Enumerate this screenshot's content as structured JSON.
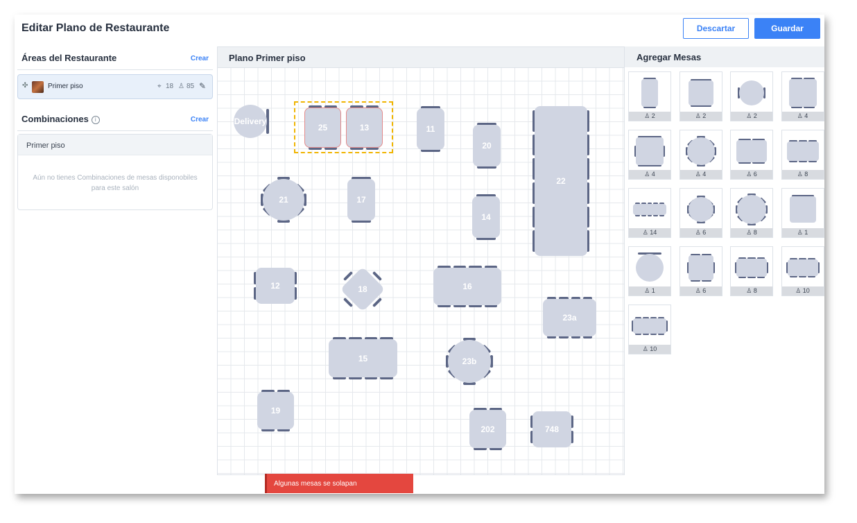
{
  "header": {
    "title": "Editar Plano de Restaurante",
    "discard_label": "Descartar",
    "save_label": "Guardar"
  },
  "sidebar": {
    "areas_title": "Áreas del Restaurante",
    "areas_create": "Crear",
    "area": {
      "name": "Primer piso",
      "tables": "18",
      "seats": "85"
    },
    "combinations_title": "Combinaciones",
    "combinations_create": "Crear",
    "combo_box_title": "Primer piso",
    "combo_empty": "Aún no tienes Combinaciones de mesas disponobiles para este salón"
  },
  "plan": {
    "title": "Plano Primer piso",
    "tables": [
      {
        "label": "Delivery"
      },
      {
        "label": "25"
      },
      {
        "label": "13"
      },
      {
        "label": "11"
      },
      {
        "label": "20"
      },
      {
        "label": "22"
      },
      {
        "label": "21"
      },
      {
        "label": "17"
      },
      {
        "label": "14"
      },
      {
        "label": "12"
      },
      {
        "label": "18"
      },
      {
        "label": "16"
      },
      {
        "label": "23a"
      },
      {
        "label": "15"
      },
      {
        "label": "23b"
      },
      {
        "label": "19"
      },
      {
        "label": "202"
      },
      {
        "label": "748"
      }
    ],
    "warning": "Algunas mesas se solapan"
  },
  "add_tables": {
    "title": "Agregar Mesas",
    "cards": [
      {
        "seats": "2"
      },
      {
        "seats": "2"
      },
      {
        "seats": "2"
      },
      {
        "seats": "4"
      },
      {
        "seats": "4"
      },
      {
        "seats": "4"
      },
      {
        "seats": "6"
      },
      {
        "seats": "8"
      },
      {
        "seats": "14"
      },
      {
        "seats": "6"
      },
      {
        "seats": "8"
      },
      {
        "seats": "1"
      },
      {
        "seats": "1"
      },
      {
        "seats": "6"
      },
      {
        "seats": "8"
      },
      {
        "seats": "10"
      },
      {
        "seats": "10"
      }
    ]
  },
  "colors": {
    "accent": "#3b82f6",
    "table": "#d0d5e2",
    "chair": "#5c6685",
    "warning": "#e4473f",
    "selection": "#f0b400"
  }
}
